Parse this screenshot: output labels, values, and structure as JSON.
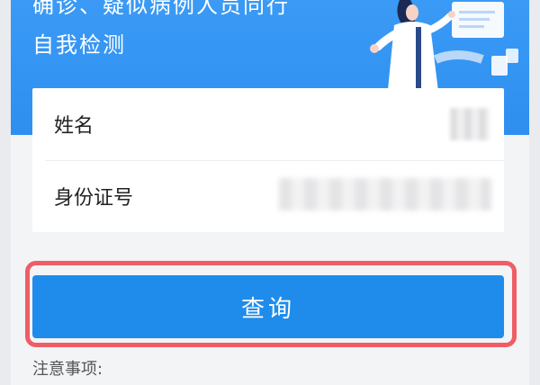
{
  "banner": {
    "line1": "确诊、疑似病例人员同行",
    "line2": "自我检测"
  },
  "form": {
    "name_label": "姓名",
    "name_value": "",
    "id_label": "身份证号",
    "id_value": ""
  },
  "actions": {
    "query_label": "查询"
  },
  "notice": {
    "title": "注意事项:"
  },
  "colors": {
    "banner_blue": "#2f8ff0",
    "button_blue": "#1f8ceb",
    "highlight_red": "#ef5d66",
    "page_bg": "#f3f4f6"
  }
}
